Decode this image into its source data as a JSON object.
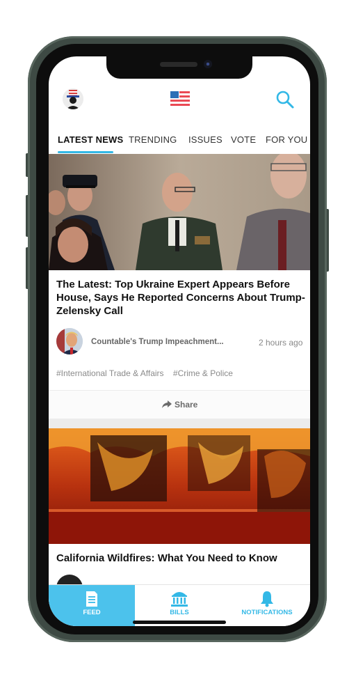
{
  "tabs": [
    {
      "label": "LATEST NEWS"
    },
    {
      "label": "TRENDING"
    },
    {
      "label": "ISSUES"
    },
    {
      "label": "VOTE"
    },
    {
      "label": "FOR YOU"
    }
  ],
  "articles": [
    {
      "headline": "The Latest: Top Ukraine Expert Appears Before House, Says He Reported Concerns About Trump-Zelensky Call",
      "source": "Countable's Trump Impeachment...",
      "time": "2 hours ago",
      "tags": [
        "#International Trade & Affairs",
        "#Crime & Police"
      ],
      "share_label": "Share"
    },
    {
      "headline": "California Wildfires: What You Need to Know"
    }
  ],
  "bottom_nav": [
    {
      "label": "FEED",
      "icon": "document-icon"
    },
    {
      "label": "BILLS",
      "icon": "capitol-building-icon"
    },
    {
      "label": "NOTIFICATIONS",
      "icon": "bell-icon"
    }
  ],
  "colors": {
    "accent": "#33b8e6",
    "feed_active": "#4cc2ec",
    "frame": "#3e4a44"
  }
}
